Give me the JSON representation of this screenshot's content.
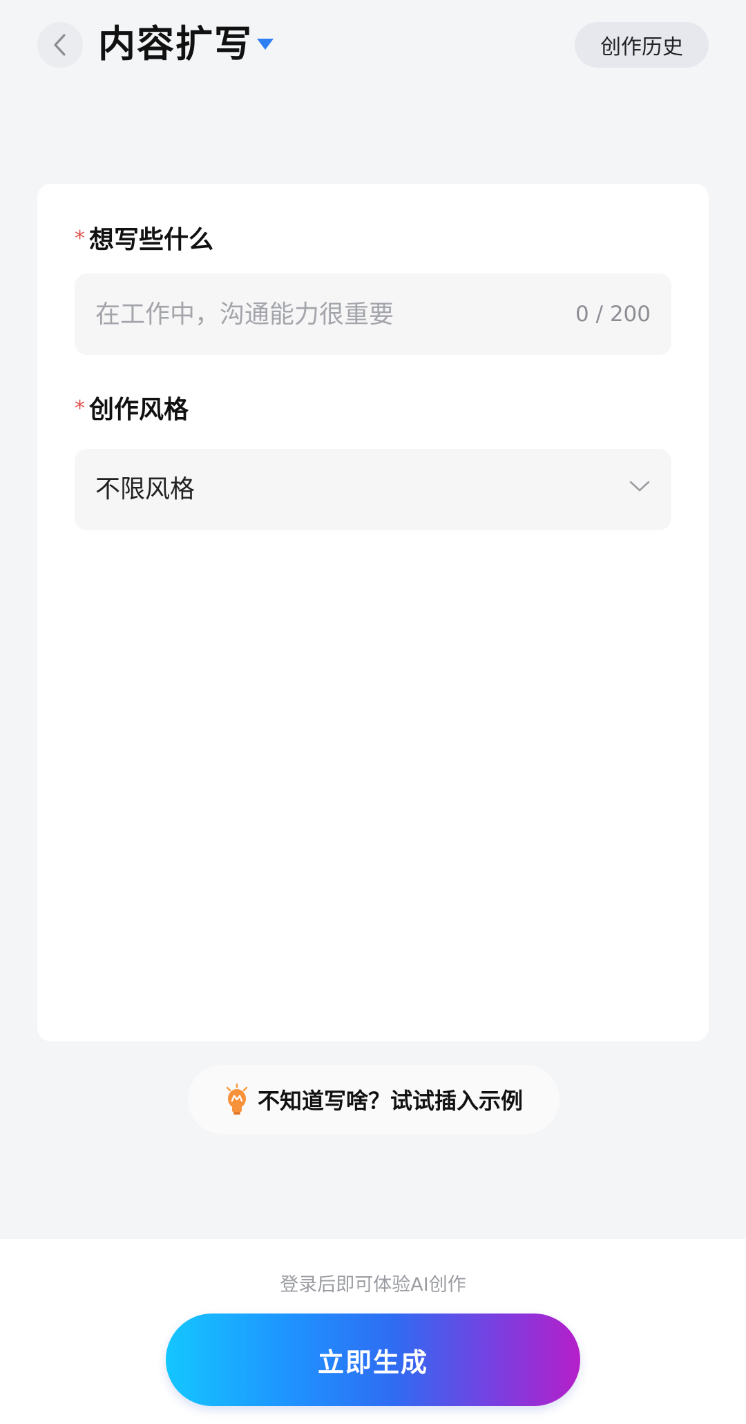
{
  "header": {
    "title": "内容扩写",
    "history_label": "创作历史"
  },
  "form": {
    "topic": {
      "required_mark": "*",
      "label": "想写些什么",
      "value": "",
      "placeholder": "在工作中，沟通能力很重要",
      "char_count": "0 / 200"
    },
    "style": {
      "required_mark": "*",
      "label": "创作风格",
      "selected": "不限风格"
    }
  },
  "example": {
    "label": "不知道写啥？试试插入示例"
  },
  "footer": {
    "login_hint": "登录后即可体验AI创作",
    "generate_label": "立即生成"
  },
  "colors": {
    "accent": "#2d7ff3",
    "required": "#e0524e",
    "background": "#f4f5f7",
    "gradient_start": "#14c6ff",
    "gradient_end": "#b51fc9"
  },
  "icons": {
    "back": "chevron-left-icon",
    "title_dropdown": "caret-down-icon",
    "select": "chevron-down-icon",
    "example": "lightbulb-icon"
  }
}
